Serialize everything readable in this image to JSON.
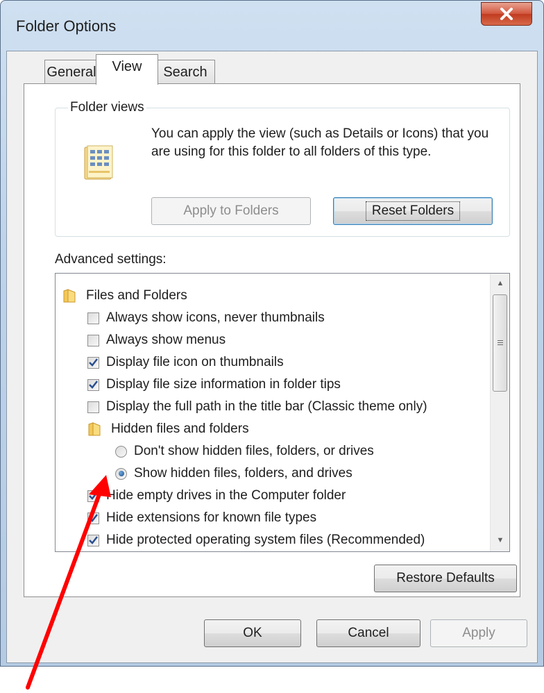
{
  "window": {
    "title": "Folder Options"
  },
  "tabs": [
    {
      "label": "General",
      "active": false
    },
    {
      "label": "View",
      "active": true
    },
    {
      "label": "Search",
      "active": false
    }
  ],
  "folder_views": {
    "legend": "Folder views",
    "description": "You can apply the view (such as Details or Icons) that you are using for this folder to all folders of this type.",
    "apply_button": "Apply to Folders",
    "reset_button": "Reset Folders"
  },
  "advanced": {
    "label": "Advanced settings:",
    "items": [
      {
        "type": "folder",
        "label": "Files and Folders",
        "indent": 0
      },
      {
        "type": "checkbox",
        "label": "Always show icons, never thumbnails",
        "checked": false,
        "indent": 1
      },
      {
        "type": "checkbox",
        "label": "Always show menus",
        "checked": false,
        "indent": 1
      },
      {
        "type": "checkbox",
        "label": "Display file icon on thumbnails",
        "checked": true,
        "indent": 1
      },
      {
        "type": "checkbox",
        "label": "Display file size information in folder tips",
        "checked": true,
        "indent": 1
      },
      {
        "type": "checkbox",
        "label": "Display the full path in the title bar (Classic theme only)",
        "checked": false,
        "indent": 1
      },
      {
        "type": "folder",
        "label": "Hidden files and folders",
        "indent": 1
      },
      {
        "type": "radio",
        "label": "Don't show hidden files, folders, or drives",
        "checked": false,
        "indent": 2
      },
      {
        "type": "radio",
        "label": "Show hidden files, folders, and drives",
        "checked": true,
        "indent": 2
      },
      {
        "type": "checkbox",
        "label": "Hide empty drives in the Computer folder",
        "checked": true,
        "indent": 1
      },
      {
        "type": "checkbox",
        "label": "Hide extensions for known file types",
        "checked": true,
        "indent": 1
      },
      {
        "type": "checkbox",
        "label": "Hide protected operating system files (Recommended)",
        "checked": true,
        "indent": 1
      }
    ]
  },
  "buttons": {
    "restore_defaults": "Restore Defaults",
    "ok": "OK",
    "cancel": "Cancel",
    "apply": "Apply"
  },
  "colors": {
    "annotation_arrow": "#ff0000",
    "close_button": "#c9462a"
  }
}
